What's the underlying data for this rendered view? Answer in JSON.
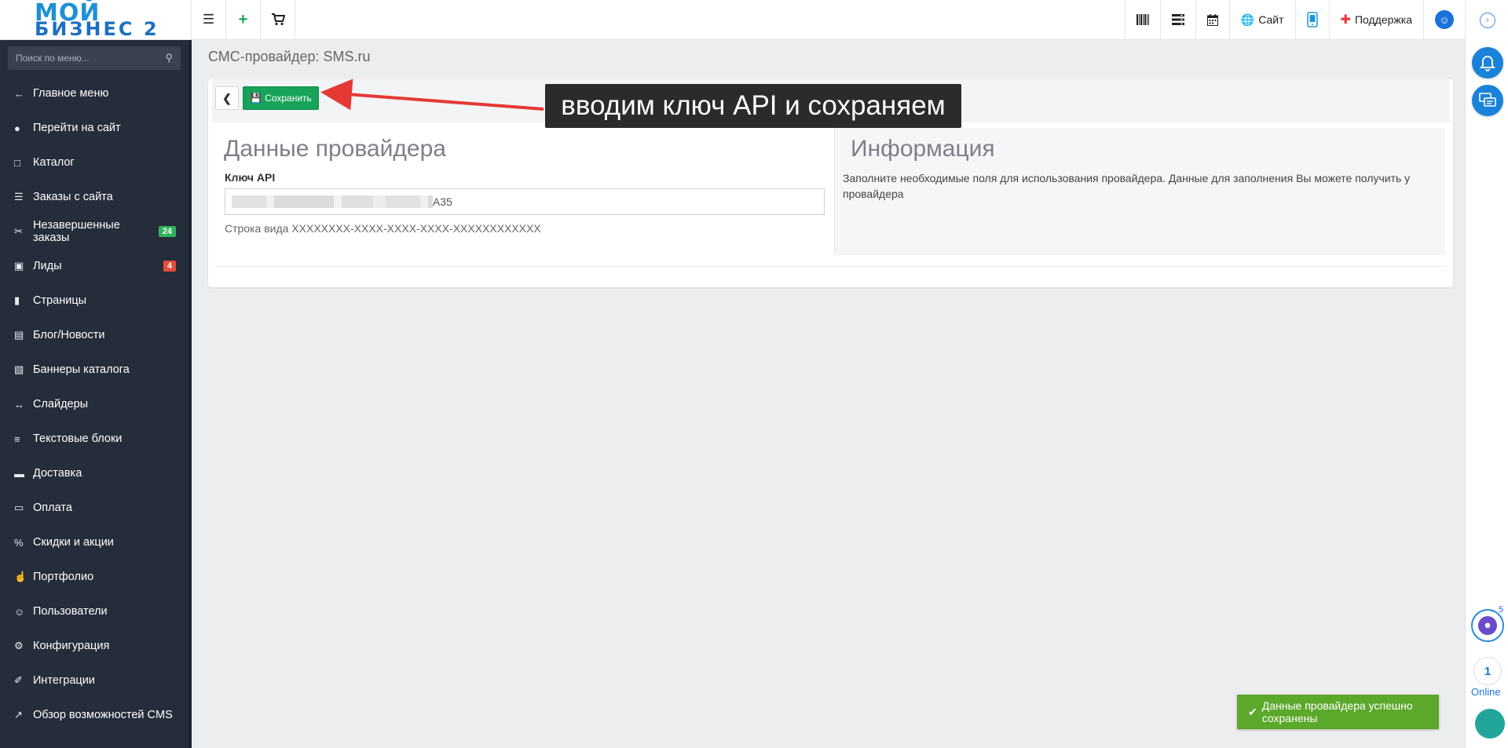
{
  "logo": {
    "line1": "МОЙ",
    "line2": "БИЗНЕС 2"
  },
  "topbar": {
    "site_label": "Сайт",
    "support_label": "Поддержка"
  },
  "sidebar": {
    "search_placeholder": "Поиск по меню...",
    "items": [
      {
        "label": "Главное меню",
        "icon": "arrow-left-icon"
      },
      {
        "label": "Перейти на сайт",
        "icon": "globe-icon"
      },
      {
        "label": "Каталог",
        "icon": "folder-icon"
      },
      {
        "label": "Заказы с сайта",
        "icon": "cart-icon"
      },
      {
        "label": "Незавершенные заказы",
        "icon": "unlink-icon",
        "badge": "24",
        "badge_color": "#2eb35a"
      },
      {
        "label": "Лиды",
        "icon": "contact-icon",
        "badge": "4",
        "badge_color": "#e74c3c"
      },
      {
        "label": "Страницы",
        "icon": "file-icon"
      },
      {
        "label": "Блог/Новости",
        "icon": "newspaper-icon"
      },
      {
        "label": "Баннеры каталога",
        "icon": "image-icon"
      },
      {
        "label": "Слайдеры",
        "icon": "arrows-h-icon"
      },
      {
        "label": "Текстовые блоки",
        "icon": "file-text-icon"
      },
      {
        "label": "Доставка",
        "icon": "truck-icon"
      },
      {
        "label": "Оплата",
        "icon": "credit-card-icon"
      },
      {
        "label": "Скидки и акции",
        "icon": "percent-icon"
      },
      {
        "label": "Портфолио",
        "icon": "thumbs-up-icon"
      },
      {
        "label": "Пользователи",
        "icon": "user-icon"
      },
      {
        "label": "Конфигурация",
        "icon": "gear-icon"
      },
      {
        "label": "Интеграции",
        "icon": "paperclip-icon"
      },
      {
        "label": "Обзор возможностей CMS",
        "icon": "line-chart-icon"
      }
    ]
  },
  "page": {
    "title": "СМС-провайдер: SMS.ru",
    "save_label": "Сохранить",
    "left_heading": "Данные провайдера",
    "api_key_label": "Ключ API",
    "api_key_visible_tail": "A35",
    "api_key_help": "Строка вида XXXXXXXX-XXXX-XXXX-XXXX-XXXXXXXXXXXX",
    "right_heading": "Информация",
    "info_text": "Заполните необходимые поля для использования провайдера. Данные для заполнения Вы можете получить у провайдера"
  },
  "annotation": {
    "text": "вводим ключ API и сохраняем",
    "arrow_color": "#e53935"
  },
  "rail": {
    "avatar_count": "5",
    "online_count": "1",
    "online_label": "Online"
  },
  "toast": {
    "text": "Данные провайдера успешно сохранены",
    "color": "#5ba82b"
  },
  "colors": {
    "sidebar_bg": "#252d3b",
    "save_button": "#17a35a",
    "accent_blue": "#1a73d9"
  }
}
